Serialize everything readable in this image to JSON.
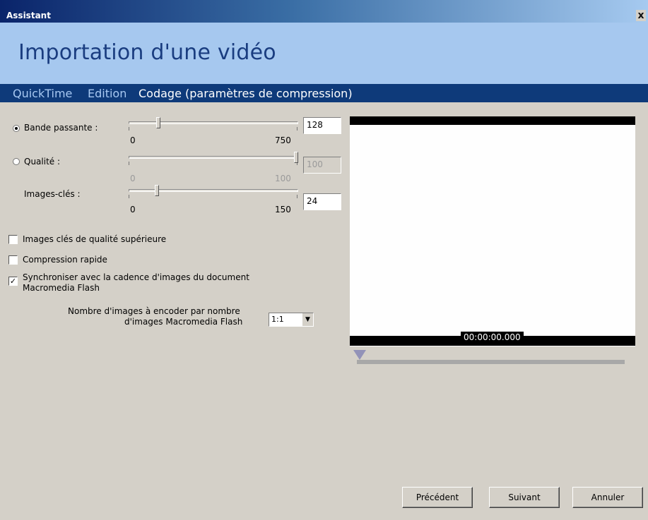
{
  "window": {
    "title": "Assistant",
    "close_label": "x"
  },
  "header": {
    "title": "Importation d'une vidéo"
  },
  "tabs": [
    {
      "label": "QuickTime"
    },
    {
      "label": "Edition"
    },
    {
      "label": "Codage (paramètres de compression)"
    }
  ],
  "settings": {
    "bandwidth": {
      "label": "Bande passante :",
      "selected": true,
      "min": "0",
      "max": "750",
      "value": "128",
      "level": 0.17
    },
    "quality": {
      "label": "Qualité :",
      "selected": false,
      "min": "0",
      "max": "100",
      "value": "100",
      "level": 1.0,
      "disabled": true
    },
    "keyframes": {
      "label": "Images-clés :",
      "min": "0",
      "max": "150",
      "value": "24",
      "level": 0.16
    }
  },
  "options": {
    "hq_keyframes": {
      "label": "Images clés de qualité supérieure",
      "checked": false
    },
    "fast_compression": {
      "label": "Compression rapide",
      "checked": false
    },
    "sync": {
      "label_line1": "Synchroniser avec la cadence d'images du document",
      "label_line2": "Macromedia Flash",
      "checked": true
    }
  },
  "frames": {
    "label_line1": "Nombre d'images à encoder par nombre",
    "label_line2": "d'images Macromedia Flash",
    "value": "1:1"
  },
  "preview": {
    "timecode": "00:00:00.000"
  },
  "buttons": {
    "previous": "Précédent",
    "next": "Suivant",
    "cancel": "Annuler"
  },
  "colors": {
    "title_gradient_start": "#0a246a",
    "header_band": "#a6c8ef",
    "tab_strip": "#0e3a7a",
    "heading_text": "#1a3d80"
  }
}
